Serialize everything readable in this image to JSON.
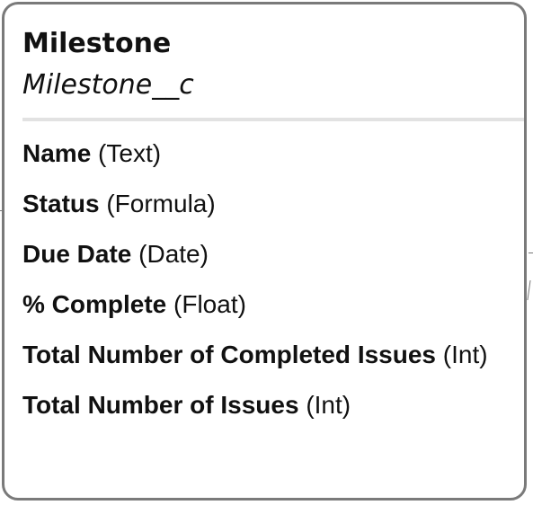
{
  "entity": {
    "label": "Milestone",
    "api_name": "Milestone__c"
  },
  "fields": [
    {
      "name": "Name",
      "type": "(Text)"
    },
    {
      "name": "Status",
      "type": "(Formula)"
    },
    {
      "name": "Due Date",
      "type": "(Date)"
    },
    {
      "name": "% Complete",
      "type": "(Float)"
    },
    {
      "name": "Total Number of Completed Issues",
      "type": "(Int)"
    },
    {
      "name": "Total Number of Issues",
      "type": "(Int)"
    }
  ]
}
